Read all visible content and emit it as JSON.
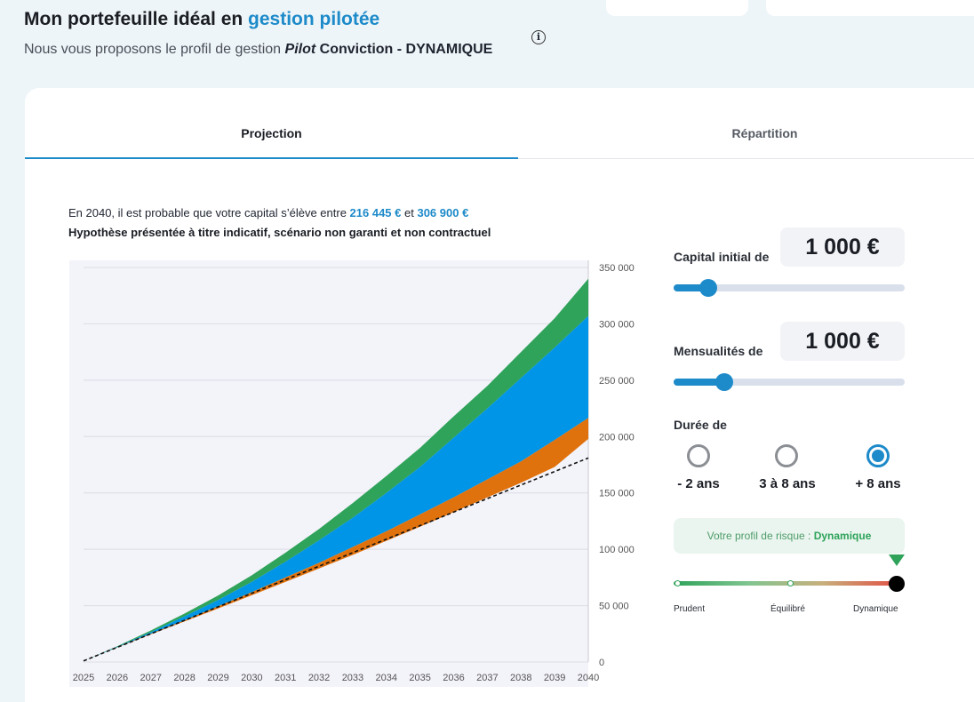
{
  "header": {
    "title_prefix": "Mon portefeuille idéal en ",
    "title_accent": "gestion pilotée",
    "subtitle_prefix": "Nous vous proposons le profil de gestion ",
    "subtitle_pilot": "Pilot",
    "subtitle_profile": "Conviction - DYNAMIQUE",
    "info_symbol": "i"
  },
  "tabs": [
    {
      "label": "Projection",
      "active": true
    },
    {
      "label": "Répartition",
      "active": false
    }
  ],
  "projection": {
    "intro_prefix": "En 2040, il est probable que votre capital s’élève entre ",
    "low_value": "216 445 €",
    "conjunction": " et ",
    "high_value": "306 900 €",
    "disclaimer": "Hypothèse présentée à titre indicatif, scénario non garanti et non contractuel"
  },
  "controls": {
    "capital": {
      "label": "Capital initial de",
      "value": "1 000 €",
      "slider_fraction": 0.15
    },
    "monthly": {
      "label": "Mensualités de",
      "value": "1 000 €",
      "slider_fraction": 0.22
    },
    "duration": {
      "label": "Durée de",
      "options": [
        {
          "label": "- 2 ans",
          "selected": false
        },
        {
          "label": "3 à 8 ans",
          "selected": false
        },
        {
          "label": "+ 8 ans",
          "selected": true
        }
      ]
    },
    "risk": {
      "text_prefix": "Votre profil de risque : ",
      "profile": "Dynamique",
      "scale": [
        "Prudent",
        "Équilibré",
        "Dynamique"
      ],
      "level_fraction": 1.0
    }
  },
  "colors": {
    "accent": "#1d8ac9",
    "green": "#2fa35a",
    "blue": "#0095e6",
    "orange": "#e0720e",
    "chart_bg": "#f3f3fa"
  },
  "chart_data": {
    "type": "area",
    "x": [
      2025,
      2026,
      2027,
      2028,
      2029,
      2030,
      2031,
      2032,
      2033,
      2034,
      2035,
      2036,
      2037,
      2038,
      2039,
      2040
    ],
    "x_tick_labels": [
      "2025",
      "2026",
      "2027",
      "2028",
      "2029",
      "2030",
      "2031",
      "2032",
      "2033",
      "2034",
      "2035",
      "2036",
      "2037",
      "2038",
      "2039",
      "2040"
    ],
    "y_tick_labels": [
      "0",
      "50 000",
      "100 000",
      "150 000",
      "200 000",
      "250 000",
      "300 000",
      "350 000"
    ],
    "ylim": [
      0,
      350000
    ],
    "y_axis_position": "right",
    "grid": true,
    "series": [
      {
        "role": "upper_green",
        "values": [
          1000,
          14000,
          28000,
          43000,
          59000,
          77000,
          97000,
          118000,
          141000,
          165000,
          190000,
          218000,
          245000,
          275000,
          305000,
          340000
        ]
      },
      {
        "role": "upper_blue",
        "values": [
          1000,
          13500,
          26500,
          40500,
          55000,
          71000,
          89000,
          108000,
          128000,
          150000,
          173000,
          199000,
          225000,
          252000,
          279000,
          306900
        ]
      },
      {
        "role": "lower_orange",
        "values": [
          1000,
          13000,
          25000,
          37000,
          49500,
          62000,
          75000,
          88000,
          102000,
          116000,
          131000,
          146000,
          162000,
          178000,
          197000,
          216445
        ]
      },
      {
        "role": "lower_white",
        "values": [
          1000,
          12800,
          24500,
          36000,
          47500,
          59200,
          71000,
          83000,
          95000,
          107500,
          120000,
          133000,
          146000,
          159000,
          173000,
          198000
        ]
      },
      {
        "role": "invested_dashed",
        "values": [
          1000,
          13000,
          25000,
          37000,
          49000,
          61000,
          73000,
          85000,
          97000,
          109000,
          121000,
          133000,
          145000,
          157000,
          169000,
          181000
        ]
      }
    ]
  }
}
